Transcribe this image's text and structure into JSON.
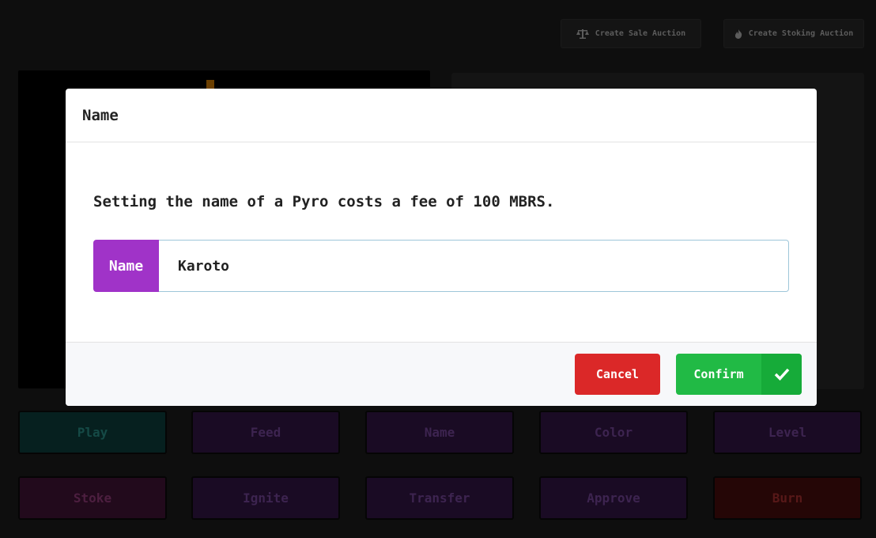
{
  "toolbar": {
    "sale_auction_label": "Create Sale Auction",
    "sale_auction_icon": "scale-icon",
    "stoking_auction_label": "Create Stoking Auction",
    "stoking_auction_icon": "flame-icon"
  },
  "actions": [
    {
      "label": "Play",
      "color": "#06201f",
      "text_color": "#154a46"
    },
    {
      "label": "Feed",
      "color": "#1a0b24",
      "text_color": "#3d2450"
    },
    {
      "label": "Name",
      "color": "#1a0b24",
      "text_color": "#3d2450"
    },
    {
      "label": "Color",
      "color": "#1a0b24",
      "text_color": "#3d2450"
    },
    {
      "label": "Level",
      "color": "#1a0b24",
      "text_color": "#3d2450"
    },
    {
      "label": "Stoke",
      "color": "#220a1c",
      "text_color": "#4d1f40"
    },
    {
      "label": "Ignite",
      "color": "#1a0b24",
      "text_color": "#3d2450"
    },
    {
      "label": "Transfer",
      "color": "#1a0b24",
      "text_color": "#3d2450"
    },
    {
      "label": "Approve",
      "color": "#1a0b24",
      "text_color": "#3d2450"
    },
    {
      "label": "Burn",
      "color": "#250606",
      "text_color": "#571818"
    }
  ],
  "modal": {
    "title": "Name",
    "fee_text": "Setting the name of a Pyro costs a fee of 100 MBRS.",
    "input_label": "Name",
    "input_value": "Karoto",
    "cancel_label": "Cancel",
    "confirm_label": "Confirm",
    "confirm_icon": "checkmark-icon",
    "addon_color": "#a033c8",
    "cancel_color": "#db2828",
    "confirm_color": "#21ba45"
  }
}
